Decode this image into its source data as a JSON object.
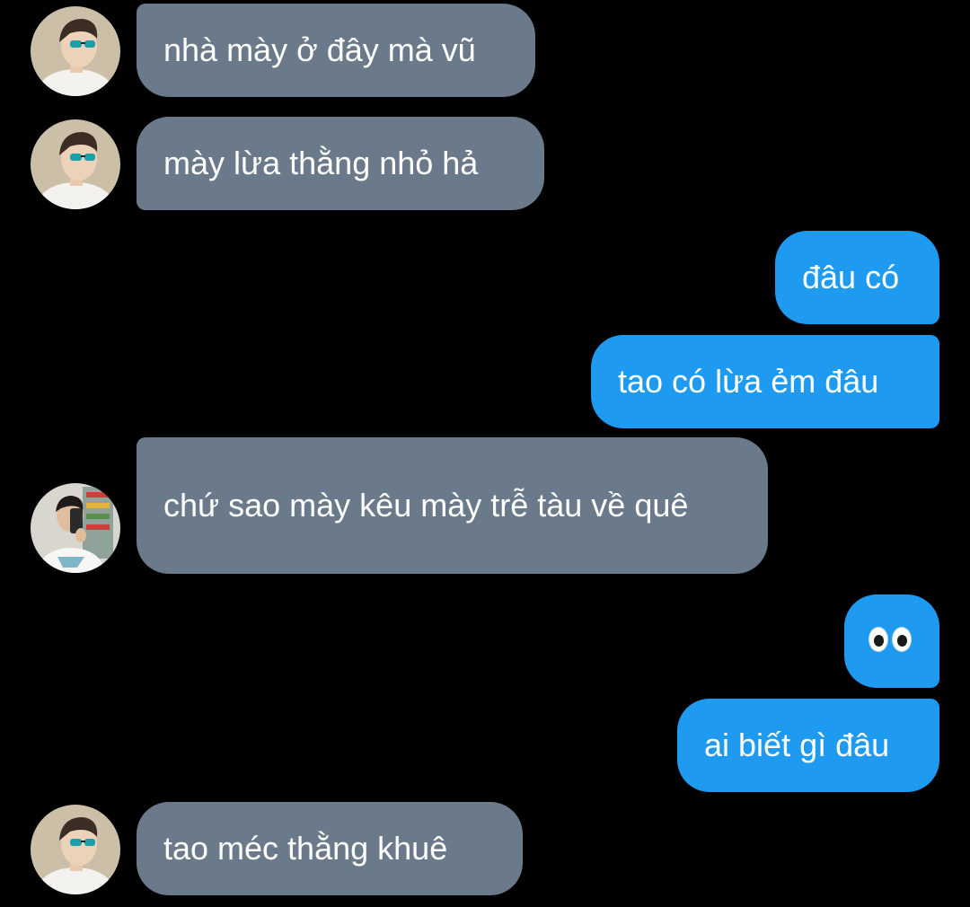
{
  "colors": {
    "background": "#000000",
    "incoming_bubble": "#6a7a8a",
    "outgoing_bubble": "#1e9bf0",
    "text": "#ffffff"
  },
  "messages": [
    {
      "direction": "incoming",
      "avatar": "avatar-sunglasses-icon",
      "text": "nhà mày ở đây mà vũ"
    },
    {
      "direction": "incoming",
      "avatar": "avatar-sunglasses-icon",
      "text": "mày lừa thằng nhỏ hả"
    },
    {
      "direction": "outgoing",
      "text": "đâu có"
    },
    {
      "direction": "outgoing",
      "text": "tao có lừa ẻm đâu"
    },
    {
      "direction": "incoming",
      "avatar": "avatar-mirror-selfie-icon",
      "text": "chứ sao mày kêu mày trễ tàu về quê"
    },
    {
      "direction": "outgoing",
      "emoji": "eyes-emoji",
      "text": "👀"
    },
    {
      "direction": "outgoing",
      "text": "ai biết gì đâu"
    },
    {
      "direction": "incoming",
      "avatar": "avatar-sunglasses-icon",
      "text": "tao méc thằng khuê"
    }
  ]
}
